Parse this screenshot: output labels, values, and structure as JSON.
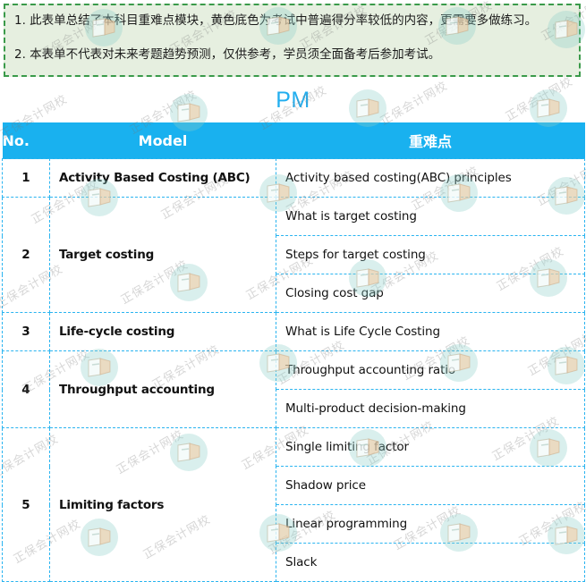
{
  "notice": {
    "line1": "1. 此表单总结了本科目重难点模块，黄色底色为考试中普遍得分率较低的内容，更需要多做练习。",
    "line2": "2. 本表单不代表对未来考题趋势预测，仅供参考，学员须全面备考后参加考试。",
    "background_color": "#e6efe0",
    "border_color": "#3a9a4a"
  },
  "title": {
    "text": "PM",
    "color": "#22aeef"
  },
  "table": {
    "header": {
      "no": "No.",
      "model": "Model",
      "topic": "重难点",
      "background_color": "#19b1ef",
      "text_color": "#ffffff"
    },
    "highlight_color": "#ffff00",
    "border_color": "#2ab4f0",
    "rows": [
      {
        "no": "1",
        "model": "Activity Based Costing (ABC)",
        "topics": [
          {
            "text": "Activity based costing(ABC) principles",
            "highlight": false
          }
        ]
      },
      {
        "no": "2",
        "model": "Target costing",
        "topics": [
          {
            "text": "What is target costing",
            "highlight": false
          },
          {
            "text": "Steps for target costing",
            "highlight": true
          },
          {
            "text": "Closing cost gap",
            "highlight": true
          }
        ]
      },
      {
        "no": "3",
        "model": "Life-cycle costing",
        "topics": [
          {
            "text": "What is Life Cycle Costing",
            "highlight": false
          }
        ]
      },
      {
        "no": "4",
        "model": "Throughput accounting",
        "topics": [
          {
            "text": "Throughput accounting ratio",
            "highlight": true
          },
          {
            "text": "Multi-product decision-making",
            "highlight": true
          }
        ]
      },
      {
        "no": "5",
        "model": "Limiting factors",
        "topics": [
          {
            "text": "Single limiting factor",
            "highlight": false
          },
          {
            "text": "Shadow price",
            "highlight": false
          },
          {
            "text": "Linear programming",
            "highlight": false
          },
          {
            "text": "Slack",
            "highlight": false
          }
        ]
      }
    ]
  },
  "watermark": {
    "text": "正保会计网校",
    "logo_name": "zhengbao-book-logo"
  }
}
